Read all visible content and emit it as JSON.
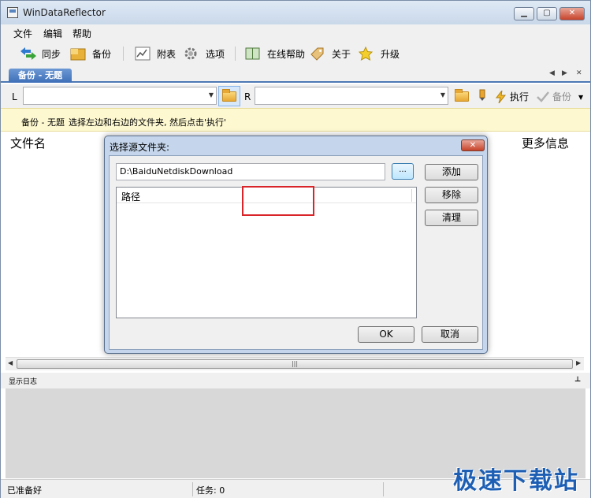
{
  "window": {
    "title": "WinDataReflector"
  },
  "menu": [
    "文件",
    "编辑",
    "帮助"
  ],
  "toolbar": {
    "sync": "同步",
    "backup": "备份",
    "report": "附表",
    "options": "选项",
    "online_help": "在线帮助",
    "about": "关于",
    "upgrade": "升级"
  },
  "tab": {
    "label": "备份 - 无题"
  },
  "paths": {
    "left_label": "L",
    "right_label": "R",
    "run_label": "执行",
    "backup_label": "备份"
  },
  "info": {
    "title": "备份 - 无题",
    "text": "选择左边和右边的文件夹, 然后点击'执行'"
  },
  "list": {
    "col_name": "文件名",
    "col_more": "更多信息"
  },
  "log": {
    "label": "显示日志"
  },
  "status": {
    "ready": "已准备好",
    "tasks": "任务: 0"
  },
  "watermark": "极速下载站",
  "dialog": {
    "title": "选择源文件夹:",
    "path_value": "D:\\BaiduNetdiskDownload",
    "browse": "...",
    "add": "添加",
    "remove": "移除",
    "clear": "清理",
    "list_header": "路径",
    "ok": "OK",
    "cancel": "取消"
  }
}
